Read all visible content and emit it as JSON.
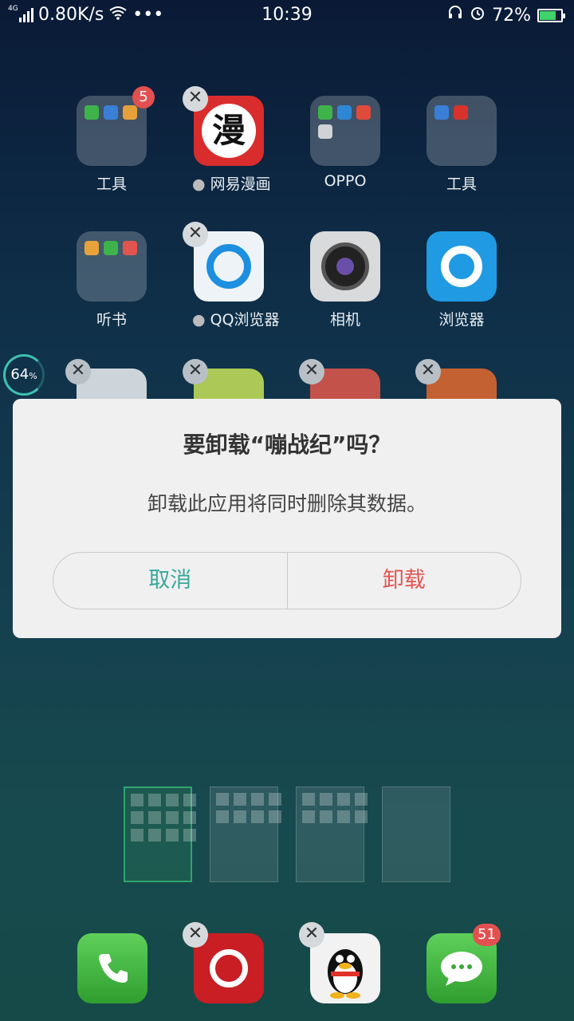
{
  "status": {
    "network_type": "4G",
    "speed": "0.80K/s",
    "more": "•••",
    "time": "10:39",
    "battery": "72%"
  },
  "apps": [
    {
      "label": "工具",
      "badge": "5"
    },
    {
      "label": "网易漫画",
      "icon_text": "漫"
    },
    {
      "label": "OPPO"
    },
    {
      "label": "工具"
    },
    {
      "label": "听书"
    },
    {
      "label": "QQ浏览器"
    },
    {
      "label": "相机"
    },
    {
      "label": "浏览器"
    }
  ],
  "ring": {
    "value": "64",
    "unit": "%"
  },
  "dialog": {
    "title": "要卸载“嘣战纪”吗？",
    "message": "卸载此应用将同时删除其数据。",
    "cancel": "取消",
    "confirm": "卸载"
  },
  "dock": {
    "messages_badge": "51"
  },
  "colors": {
    "accent_teal": "#3aa89a",
    "danger_red": "#e2554f",
    "badge_red": "#e35050"
  }
}
